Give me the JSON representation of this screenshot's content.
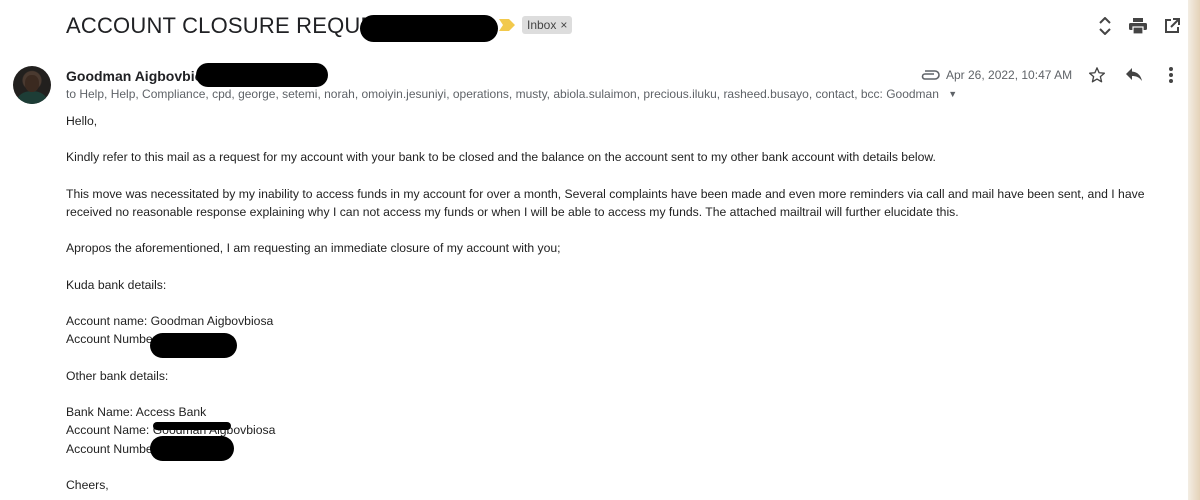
{
  "email": {
    "subject": "ACCOUNT CLOSURE REQUEST",
    "label": "Inbox",
    "label_close": "×",
    "sender": {
      "name": "Goodman Aigbovbios",
      "recipients": "to Help, Help, Compliance, cpd, george, setemi, norah, omoiyin.jesuniyi, operations, musty, abiola.sulaimon, precious.iluku, rasheed.busayo, contact, bcc: Goodman",
      "date": "Apr 26, 2022, 10:47 AM"
    },
    "body": {
      "greeting": "Hello,",
      "p1": "Kindly refer to this mail as a request for my account with your bank to be closed and the balance on the account sent to my other bank account with details below.",
      "p2a": "This move was necessitated by my inability to access funds in my account for over a month, Several complaints have been made and even more reminders via call and mail have been sent, and I have",
      "p2b": "received no reasonable response explaining why I can not access my funds or when I will be able to access my funds. The attached mailtrail will further elucidate this.",
      "p3": "Apropos the aforementioned, I am requesting an immediate closure of my account with you;",
      "kuda_heading": "Kuda bank details:",
      "kuda_account_name": "Account name: Goodman Aigbovbiosa",
      "kuda_account_number": "Account Numbe",
      "other_heading": "Other bank details:",
      "bank_name": "Bank Name: Access Bank",
      "other_account_name": "Account Name: Goodman Aigbovbiosa",
      "other_account_number": "Account Numbe",
      "signoff": "Cheers,"
    }
  },
  "icons": {
    "expand": "unfold-icon",
    "print": "print-icon",
    "open_new": "open-in-new-icon",
    "attachment": "paperclip-icon",
    "star": "star-icon",
    "reply": "reply-icon",
    "more": "more-vert-icon",
    "importance": "importance-marker-icon"
  },
  "colors": {
    "importance": "#f2c94c",
    "label_bg": "#dddddd",
    "meta_text": "#5f6368"
  }
}
